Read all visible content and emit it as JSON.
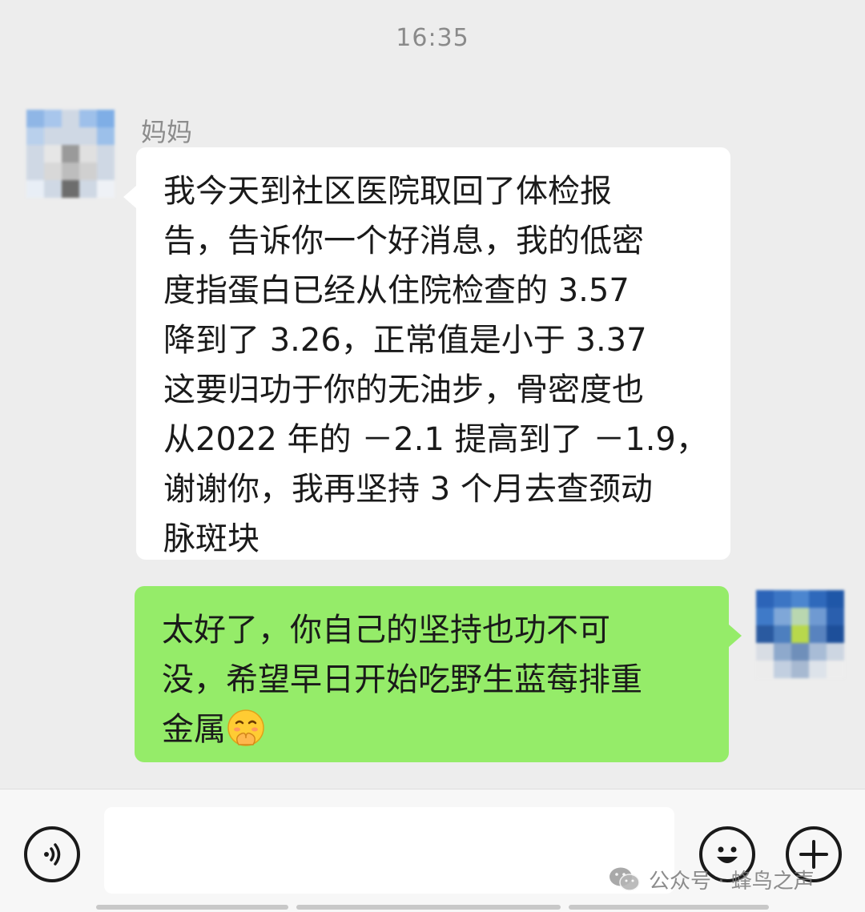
{
  "chat": {
    "timestamp": "16:35",
    "incoming": {
      "sender_name": "妈妈",
      "lines": [
        "我今天到社区医院取回了体检报",
        "告，告诉你一个好消息，我的低密",
        "度指蛋白已经从住院检查的 3.57",
        "降到了 3.26，正常值是小于 3.37",
        "这要归功于你的无油步，骨密度也",
        "从2022 年的 －2.1 提高到了 －1.9，",
        "谢谢你，我再坚持 3 个月去查颈动",
        "脉斑块"
      ]
    },
    "outgoing": {
      "lines": [
        "太好了，你自己的坚持也功不可",
        "没，希望早日开始吃野生蓝莓排重",
        "金属"
      ],
      "trailing_emoji": "hugging-face-emoji"
    }
  },
  "input_bar": {
    "message_value": "",
    "voice_icon": "voice-icon",
    "emoji_icon": "smiley-icon",
    "plus_icon": "plus-icon"
  },
  "watermark": {
    "text": "公众号 · 蜂鸟之声"
  },
  "colors": {
    "background": "#ededed",
    "incoming_bubble": "#ffffff",
    "outgoing_bubble": "#95ec69"
  }
}
